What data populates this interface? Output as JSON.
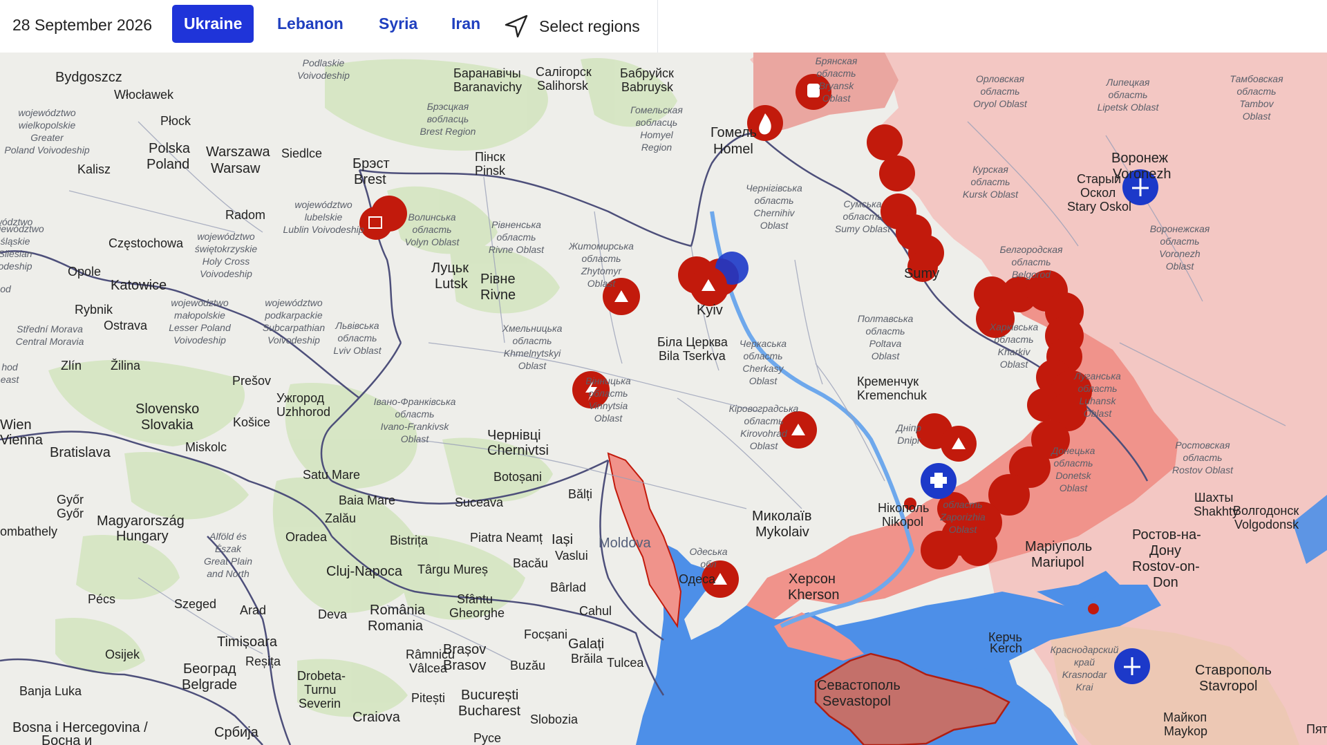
{
  "header": {
    "date": "28 September 2026",
    "tabs": [
      {
        "label": "Ukraine",
        "active": true
      },
      {
        "label": "Lebanon",
        "active": false
      },
      {
        "label": "Syria",
        "active": false
      },
      {
        "label": "Iran",
        "active": false
      }
    ],
    "select_regions": "Select regions"
  },
  "colors": {
    "accent": "#1f34d9",
    "occupied_fill": "#f0938b",
    "russia_fill": "#f3c4c0",
    "incident_marker": "#c21a0c",
    "marker_blue": "#1c39c9",
    "sea": "#4d8fe8"
  },
  "labels": {
    "bydgoszcz": "Bydgoszcz",
    "wloclawek": "Włocławek",
    "plock": "Płock",
    "warszawa": "Warszawa",
    "warsaw": "Warsaw",
    "siedlce": "Siedlce",
    "brest_uk": "Брэст",
    "brest": "Brest",
    "radom": "Radom",
    "czestochowa": "Częstochowa",
    "opole": "Opole",
    "katowice": "Katowice",
    "rybnik": "Rybnik",
    "ostrava": "Ostrava",
    "zilina": "Žilina",
    "zlin": "Zlín",
    "presov": "Prešov",
    "kosice": "Košice",
    "bratislava": "Bratislava",
    "wien": "Wien",
    "vienna": "Vienna",
    "miskolc": "Miskolc",
    "gyor1": "Győr",
    "gyor2": "Győr",
    "szombathely": "ombathely",
    "magyar": "Magyarország",
    "hungary": "Hungary",
    "pecs": "Pécs",
    "szeged": "Szeged",
    "slovensko": "Slovensko",
    "slovakia": "Slovakia",
    "polska": "Polska",
    "poland": "Poland",
    "kalisz": "Kalisz",
    "lutsk_uk": "Луцьк",
    "lutsk": "Lutsk",
    "rivne_uk": "Рівне",
    "rivne": "Rivne",
    "pinsk_uk": "Пінск",
    "pinsk": "Pinsk",
    "baranavichy_uk": "Баранавічы",
    "baranavichy": "Baranavichy",
    "salihorsk_uk": "Салігорск",
    "salihorsk": "Salihorsk",
    "babruysk_uk": "Бабруйск",
    "babruysk": "Babruysk",
    "homel_uk": "Гомель",
    "homel": "Homel",
    "kyiv": "Kyiv",
    "bila_uk": "Біла Церква",
    "bila": "Bila Tserkva",
    "kremenchuk_uk": "Кременчук",
    "kremenchuk": "Kremenchuk",
    "sumy": "Sumy",
    "chernivtsi_uk": "Чернівці",
    "chernivtsi": "Chernivtsi",
    "uzhhorod_uk": "Ужгород",
    "uzhhorod": "Uzhhorod",
    "mykolaiv_uk": "Миколаїв",
    "mykolaiv": "Mykolaiv",
    "kherson_uk": "Херсон",
    "kherson": "Kherson",
    "nikopol_uk": "Нікополь",
    "nikopol": "Nikopol",
    "mariupol_uk": "Маріуполь",
    "mariupol": "Mariupol",
    "sevastopol_uk": "Севастополь",
    "sevastopol": "Sevastopol",
    "kerch_uk": "Керчь",
    "kerch": "Kerch",
    "odesa": "Одесa",
    "moldova": "Moldova",
    "iasi": "Iași",
    "vaslui": "Vaslui",
    "balti": "Bălți",
    "botosani": "Botoșani",
    "suceava": "Suceava",
    "piatra": "Piatra Neamț",
    "bacau": "Bacău",
    "barlad": "Bârlad",
    "cahul": "Cahul",
    "galati": "Galați",
    "tulcea": "Tulcea",
    "braila": "Brăila",
    "focsani": "Focșani",
    "buzau": "Buzău",
    "brasov1": "Brașov",
    "brasov2": "Brasov",
    "sfantu": "Sfântu",
    "gheorghe": "Gheorghe",
    "romania1": "România",
    "romania2": "Romania",
    "cluj": "Cluj-Napoca",
    "targu": "Târgu Mureș",
    "bistrita": "Bistrița",
    "baia": "Baia Mare",
    "satu": "Satu Mare",
    "oradea": "Oradea",
    "zalau": "Zalău",
    "deva": "Deva",
    "arad": "Arad",
    "timisoara": "Timișoara",
    "resita": "Reșița",
    "rmvalcea1": "Râmnicu",
    "rmvalcea2": "Vâlcea",
    "pitesti": "Pitești",
    "bucuresti": "București",
    "bucharest": "Bucharest",
    "slobozia": "Slobozia",
    "craiova": "Craiova",
    "drobeta1": "Drobeta-",
    "drobeta2": "Turnu",
    "drobeta3": "Severin",
    "pyce": "Pyce",
    "beograd1": "Београд",
    "beograd2": "Belgrade",
    "osijek": "Osijek",
    "banja": "Banja Luka",
    "bosna1": "Bosna i Hercegovina /",
    "bosna2": "Босна и",
    "srbija": "Србија",
    "voronezh_uk": "Воронеж",
    "voronezh": "Voronezh",
    "stary_uk": "Старый",
    "stary_uk2": "Оскол",
    "stary": "Stary Oskol",
    "shakhty1": "Шахты",
    "shakhty2": "Shakhty",
    "volgodonsk1": "Волгодонск",
    "volgodonsk2": "Volgodonsk",
    "rostov1": "Ростов-на-",
    "rostov2": "Дону",
    "rostov3": "Rostov-on-",
    "rostov4": "Don",
    "stavropol1": "Ставрополь",
    "stavropol2": "Stavropol",
    "maykop1": "Майкоп",
    "maykop2": "Maykop",
    "pyat": "Пяти"
  },
  "region_labels": {
    "bryansk": [
      "Брянская",
      "область",
      "Bryansk",
      "Oblast"
    ],
    "orel": [
      "Орловская",
      "область",
      "Oryol Oblast"
    ],
    "lipetsk": [
      "Липецкая",
      "область",
      "Lipetsk Oblast"
    ],
    "tambov": [
      "Тамбовская",
      "область",
      "Tambov",
      "Oblast"
    ],
    "kursk": [
      "Курская",
      "область",
      "Kursk Oblast"
    ],
    "belgorod": [
      "Белгородская",
      "область",
      "Belgorod"
    ],
    "voronezh_obl": [
      "Воронежская",
      "область",
      "Voronezh",
      "Oblast"
    ],
    "homel_reg": [
      "Гомельская",
      "вобласць",
      "Homyel",
      "Region"
    ],
    "brest_reg": [
      "Брэсцкая",
      "вобласць",
      "Brest Region"
    ],
    "chernihiv": [
      "Чернігівська",
      "область",
      "Chernihiv",
      "Oblast"
    ],
    "sumy_obl": [
      "Сумська",
      "область",
      "Sumy Oblast"
    ],
    "zhytomyr": [
      "Житомирська",
      "область",
      "Zhytomyr",
      "Oblast"
    ],
    "volyn": [
      "Волинська",
      "область",
      "Volyn Oblast"
    ],
    "rivne_obl": [
      "Рівненська",
      "область",
      "Rivne Oblast"
    ],
    "lviv": [
      "Львівська",
      "область",
      "Lviv Oblast"
    ],
    "khmelnytskyi": [
      "Хмельницька",
      "область",
      "Khmelnytskyi",
      "Oblast"
    ],
    "vinnytsia": [
      "Вінницька",
      "область",
      "Vinnytsia",
      "Oblast"
    ],
    "ivano": [
      "Івано-Франківська",
      "область",
      "Ivano-Frankivsk",
      "Oblast"
    ],
    "cherkasy": [
      "Черкаська",
      "область",
      "Cherkasy",
      "Oblast"
    ],
    "poltava": [
      "Полтавська",
      "область",
      "Poltava",
      "Oblast"
    ],
    "kirovohrad": [
      "Кіровоградська",
      "область",
      "Kirovohrad",
      "Oblast"
    ],
    "kharkiv": [
      "Харківська",
      "область",
      "Kharkiv",
      "Oblast"
    ],
    "luhansk": [
      "Луганська",
      "область",
      "Luhansk",
      "Oblast"
    ],
    "donetsk": [
      "Донецька",
      "область",
      "Donetsk",
      "Oblast"
    ],
    "zaporizhia": [
      "область",
      "Zaporizhia",
      "Oblast"
    ],
    "dnipro": [
      "Дніпр",
      "Dnipr"
    ],
    "odesa_obl": [
      "Одеська",
      "обл"
    ],
    "rostov_obl": [
      "Ростовская",
      "область",
      "Rostov Oblast"
    ],
    "krasnodar": [
      "Краснодарский",
      "край",
      "Krasnodar",
      "Krai"
    ],
    "wielkopolska": [
      "województwo",
      "wielkopolskie",
      "Greater",
      "Poland Voivodeship"
    ],
    "podlaskie": [
      "Podlaskie",
      "Voivodeship"
    ],
    "lubelskie": [
      "województwo",
      "lubelskie",
      "Lublin Voivodeship"
    ],
    "swietokrzyskie": [
      "województwo",
      "świętokrzyskie",
      "Holy Cross",
      "Voivodeship"
    ],
    "malopolskie": [
      "województwo",
      "małopolskie",
      "Lesser Poland",
      "Voivodeship"
    ],
    "podkarpackie": [
      "województwo",
      "podkarpackie",
      "Subcarpathian",
      "Voivodeship"
    ],
    "slaskie": [
      "województwo",
      "śląskie",
      "Silesian",
      "odeship"
    ],
    "moravia": [
      "Střední Morava",
      "Central Moravia"
    ],
    "alfold": [
      "Alföld és",
      "Észak",
      "Great Plain",
      "and North"
    ],
    "vodz": [
      "wództwo"
    ],
    "hod": [
      "hod",
      "east"
    ],
    "od": [
      "od"
    ]
  }
}
